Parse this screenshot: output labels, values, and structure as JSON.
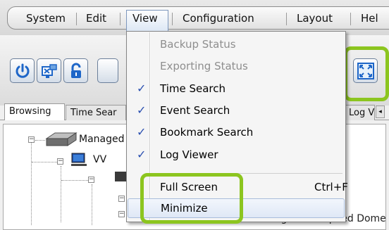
{
  "menubar": {
    "items": [
      {
        "label": "System"
      },
      {
        "label": "Edit"
      },
      {
        "label": "View"
      },
      {
        "label": "Configuration"
      },
      {
        "label": "Layout"
      },
      {
        "label": "Hel"
      }
    ]
  },
  "toolbar": {
    "buttons": [
      {
        "icon": "power-icon"
      },
      {
        "icon": "network-monitor-icon"
      },
      {
        "icon": "lock-icon"
      },
      {
        "icon": "fullscreen-icon"
      }
    ],
    "highlight_color": "#8cc51f"
  },
  "tabs": [
    {
      "label": "Browsing"
    },
    {
      "label": "Time Sear"
    },
    {
      "label": "Log V"
    }
  ],
  "tree": {
    "root": "Managed",
    "child": "VV",
    "row_fragment": "Zoom Mega-Pixel Speed Dome Net"
  },
  "view_menu": {
    "items": [
      {
        "label": "Backup Status",
        "enabled": false,
        "checked": false
      },
      {
        "label": "Exporting Status",
        "enabled": false,
        "checked": false
      },
      {
        "label": "Time Search",
        "enabled": true,
        "checked": true
      },
      {
        "label": "Event Search",
        "enabled": true,
        "checked": true
      },
      {
        "label": "Bookmark Search",
        "enabled": true,
        "checked": true
      },
      {
        "label": "Log Viewer",
        "enabled": true,
        "checked": true
      },
      {
        "label": "Full Screen",
        "enabled": true,
        "checked": false,
        "shortcut": "Ctrl+F"
      },
      {
        "label": "Minimize",
        "enabled": true,
        "checked": false
      }
    ],
    "check_glyph": "✓"
  }
}
